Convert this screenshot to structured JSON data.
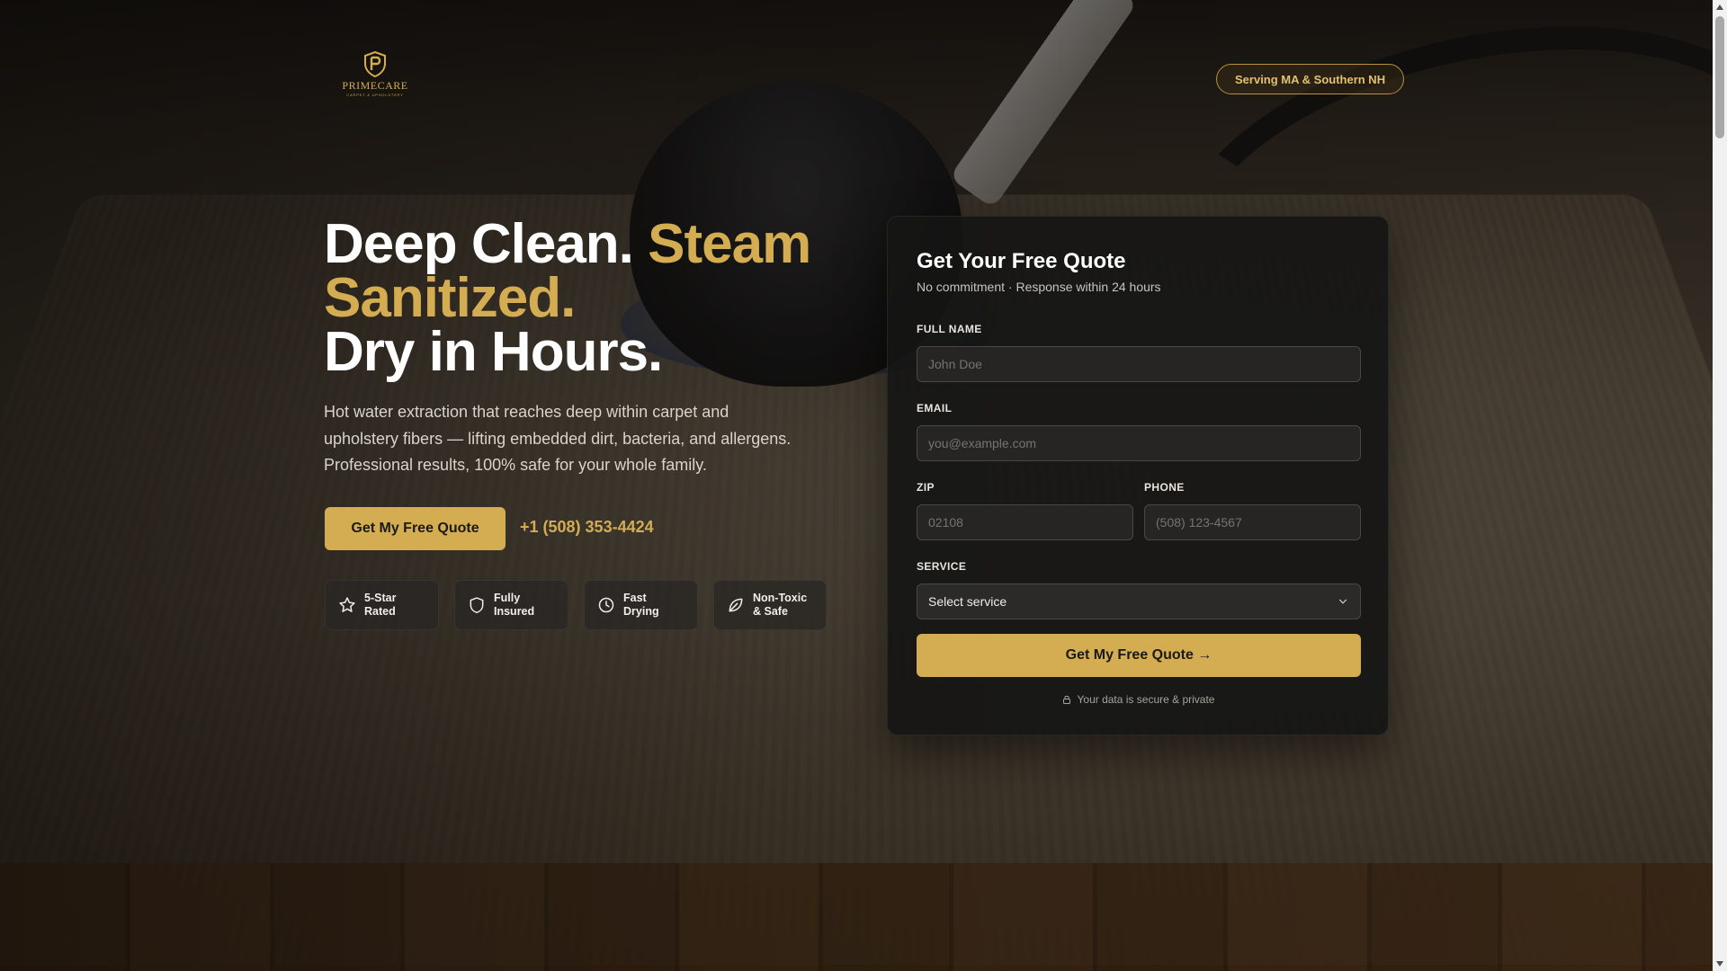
{
  "brand": {
    "name": "PRIMECARE",
    "tagline": "CARPET & UPHOLSTERY",
    "accent_color": "#d4ad52"
  },
  "header": {
    "service_area": "Serving MA & Southern NH"
  },
  "hero": {
    "headline_white_1": "Deep Clean.",
    "headline_gold": "Steam Sanitized.",
    "headline_white_2": "Dry in Hours.",
    "description": "Hot water extraction that reaches deep within carpet and upholstery fibers — lifting embedded dirt, bacteria, and allergens. Professional results, 100% safe for your whole family.",
    "cta_label": "Get My Free Quote",
    "phone": "+1 (508) 353-4424",
    "badges": [
      {
        "label": "5-Star Rated",
        "icon": "star-icon"
      },
      {
        "label": "Fully Insured",
        "icon": "shield-icon"
      },
      {
        "label": "Fast Drying",
        "icon": "clock-icon"
      },
      {
        "label": "Non-Toxic & Safe",
        "icon": "leaf-icon"
      }
    ]
  },
  "form": {
    "title": "Get Your Free Quote",
    "subtitle": "No commitment · Response within 24 hours",
    "full_name": {
      "label": "FULL NAME",
      "placeholder": "John Doe"
    },
    "email": {
      "label": "EMAIL",
      "placeholder": "you@example.com"
    },
    "zip": {
      "label": "ZIP",
      "placeholder": "02108"
    },
    "phone": {
      "label": "PHONE",
      "placeholder": "(508) 123-4567"
    },
    "service": {
      "label": "SERVICE",
      "selected": "Select service"
    },
    "submit_label": "Get My Free Quote →",
    "secure_note": "Your data is secure & private"
  }
}
